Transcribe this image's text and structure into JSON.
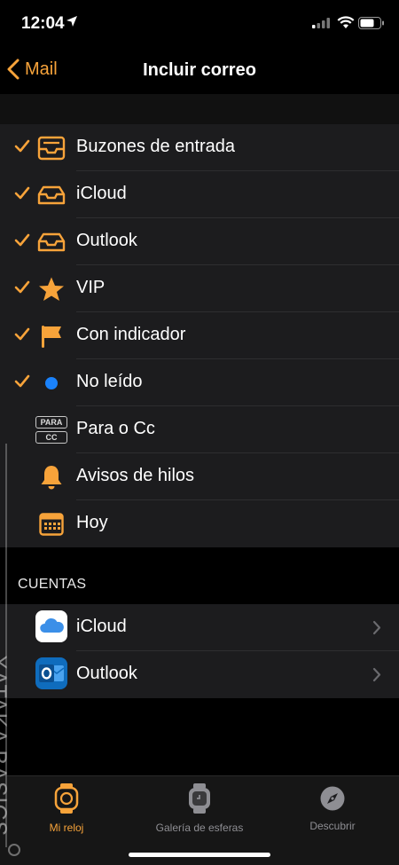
{
  "status_bar": {
    "time": "12:04"
  },
  "nav": {
    "back_label": "Mail",
    "title": "Incluir correo"
  },
  "mailbox_rows": [
    {
      "label": "Buzones de entrada",
      "checked": true,
      "icon": "inbox-tray-icon"
    },
    {
      "label": "iCloud",
      "checked": true,
      "icon": "inbox-tray-icon"
    },
    {
      "label": "Outlook",
      "checked": true,
      "icon": "inbox-tray-icon"
    },
    {
      "label": "VIP",
      "checked": true,
      "icon": "star-icon"
    },
    {
      "label": "Con indicador",
      "checked": true,
      "icon": "flag-icon"
    },
    {
      "label": "No leído",
      "checked": true,
      "icon": "blue-dot-icon"
    },
    {
      "label": "Para o Cc",
      "checked": false,
      "icon": "to-cc-icon",
      "icon_text": [
        "PARA",
        "CC"
      ]
    },
    {
      "label": "Avisos de hilos",
      "checked": false,
      "icon": "bell-icon"
    },
    {
      "label": "Hoy",
      "checked": false,
      "icon": "calendar-icon"
    }
  ],
  "accounts": {
    "header": "CUENTAS",
    "rows": [
      {
        "label": "iCloud",
        "icon": "icloud-icon"
      },
      {
        "label": "Outlook",
        "icon": "outlook-icon"
      }
    ]
  },
  "tab_bar": {
    "tabs": [
      {
        "label": "Mi reloj",
        "active": true,
        "icon": "watch-icon"
      },
      {
        "label": "Galería de esferas",
        "active": false,
        "icon": "watch-face-icon"
      },
      {
        "label": "Descubrir",
        "active": false,
        "icon": "compass-icon"
      }
    ]
  },
  "watermark": "XATAKA BASICS",
  "colors": {
    "accent": "#f7a33a",
    "blue_dot": "#1a82fb",
    "background": "#000000",
    "cell": "#1c1c1e"
  }
}
